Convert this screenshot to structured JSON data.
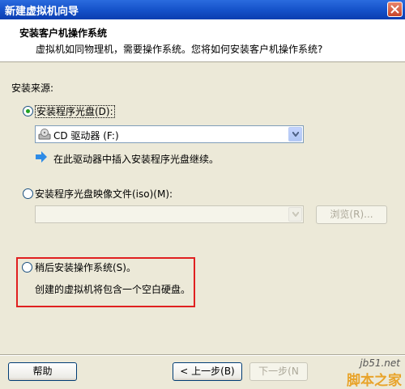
{
  "window": {
    "title": "新建虚拟机向导"
  },
  "header": {
    "title": "安装客户机操作系统",
    "subtitle": "虚拟机如同物理机，需要操作系统。您将如何安装客户机操作系统?"
  },
  "source": {
    "label": "安装来源:",
    "disc_option": {
      "label": "安装程序光盘(D):",
      "selected": true,
      "drive_value": "CD 驱动器 (F:)",
      "hint": "在此驱动器中插入安装程序光盘继续。"
    },
    "iso_option": {
      "label": "安装程序光盘映像文件(iso)(M):",
      "selected": false,
      "value": "",
      "browse_label": "浏览(R)..."
    },
    "later_option": {
      "label": "稍后安装操作系统(S)。",
      "selected": false,
      "description": "创建的虚拟机将包含一个空白硬盘。"
    }
  },
  "footer": {
    "help_label": "帮助",
    "back_label": "< 上一步(B)",
    "next_label": "下一步(N"
  },
  "watermark": {
    "site": "jb51.net",
    "name": "脚本之家"
  },
  "colors": {
    "accent": "#2A6BDE",
    "highlight": "#E02020",
    "radio_dot": "#21A121"
  }
}
